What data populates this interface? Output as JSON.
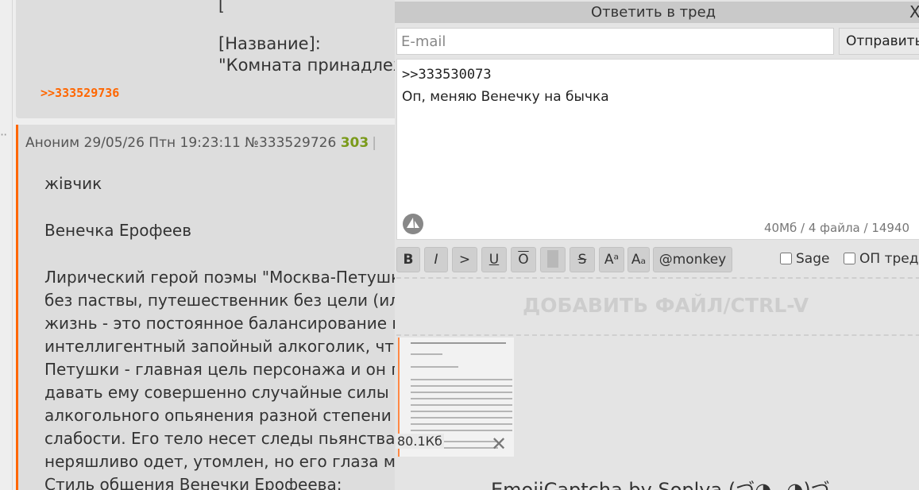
{
  "thread": {
    "top_post": {
      "bracket": "[",
      "name_label": "[Название]:",
      "name_value": "\"Комната принадлеж",
      "reply_link": ">>333529736"
    },
    "main_post": {
      "author": "Аноним",
      "date": "29/05/26 Птн 19:23:11",
      "number": "№333529726",
      "replies_count": "303",
      "separator": "|",
      "body": [
        "жівчик",
        "",
        "Венечка Ерофеев",
        "",
        "Лирический герой поэмы \"Москва-Петушк",
        "без паствы, путешественник без цели (ил",
        "жизнь - это постоянное балансирование н",
        "интеллигентный запойный алкоголик, что",
        "Петушки - главная цель персонажа и он го",
        "давать ему совершенно случайные силы и",
        "алкогольного опьянения разной степени -",
        "слабости. Его тело несет следы пьянства:",
        "неряшливо одет, утомлен, но его глаза мо",
        "Стиль общения Венечки Ерофеева:"
      ]
    }
  },
  "reply_form": {
    "title": "Ответить в тред",
    "close_label": "X",
    "email_placeholder": "E-mail",
    "email_value": "",
    "submit_label": "Отправить",
    "message_lines": [
      ">>333530073",
      "Оп, меняю Венечку на бычка"
    ],
    "limits": "40Мб / 4 файла / 14940",
    "toolbar": [
      "B",
      "I",
      ">",
      "U",
      "O",
      "",
      "S",
      "Aᵃ",
      "Aₐ",
      "@monkey"
    ],
    "sage_label": "Sage",
    "op_label": "ОП тред",
    "dropzone_label": "ДОБАВИТЬ ФАЙЛ/CTRL-V",
    "attachment": {
      "size": "80.1Кб",
      "remove_icon": "close-icon"
    },
    "captcha_label": "EmojiCaptcha by Soplya (づ◕‿◕)づ"
  },
  "colors": {
    "accent": "#ff6600",
    "replies": "#7a9a1a",
    "post_bg": "#dddddd",
    "form_bg": "#e4e4e4"
  }
}
